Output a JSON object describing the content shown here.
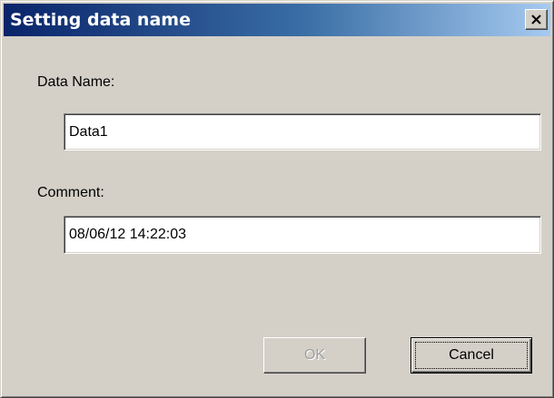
{
  "window": {
    "title": "Setting data name",
    "close_icon": "close-icon"
  },
  "form": {
    "data_name_label": "Data Name:",
    "data_name_value": "Data1",
    "comment_label": "Comment:",
    "comment_value": "08/06/12 14:22:03"
  },
  "buttons": {
    "ok_label": "OK",
    "ok_enabled": false,
    "cancel_label": "Cancel",
    "cancel_focused": true
  },
  "colors": {
    "titlebar_start": "#0a246a",
    "titlebar_end": "#a6caf0",
    "dialog_face": "#d4d0c8",
    "disabled_text": "#a0a0a0"
  }
}
